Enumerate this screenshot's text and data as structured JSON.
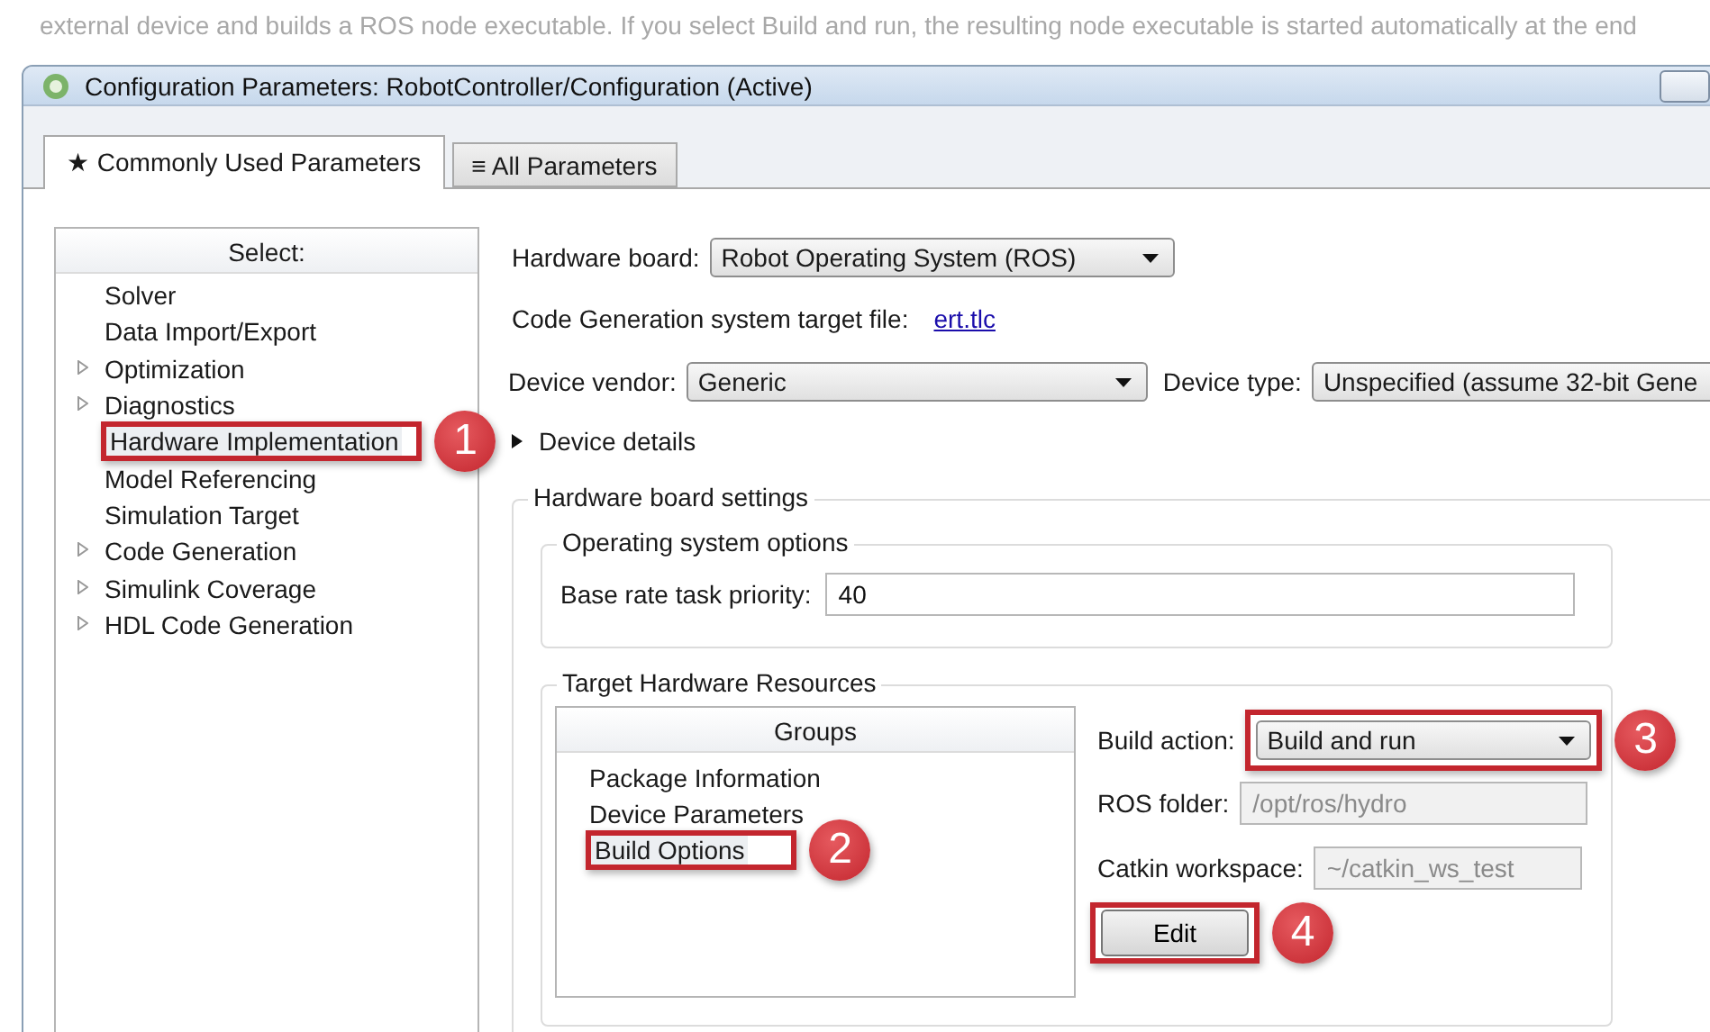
{
  "caption": "external device and builds a ROS node executable. If you select Build and run, the resulting node executable is started automatically at the end",
  "window": {
    "title": "Configuration Parameters: RobotController/Configuration (Active)"
  },
  "tabs": [
    {
      "icon": "★",
      "label": "Commonly Used Parameters",
      "selected": true
    },
    {
      "icon": "≡",
      "label": "All Parameters",
      "selected": false
    }
  ],
  "sidebar": {
    "header": "Select:",
    "items": [
      {
        "label": "Solver",
        "expandable": false,
        "selected": false
      },
      {
        "label": "Data Import/Export",
        "expandable": false,
        "selected": false
      },
      {
        "label": "Optimization",
        "expandable": true,
        "selected": false
      },
      {
        "label": "Diagnostics",
        "expandable": true,
        "selected": false
      },
      {
        "label": "Hardware Implementation",
        "expandable": false,
        "selected": true,
        "callout": "1"
      },
      {
        "label": "Model Referencing",
        "expandable": false,
        "selected": false
      },
      {
        "label": "Simulation Target",
        "expandable": false,
        "selected": false
      },
      {
        "label": "Code Generation",
        "expandable": true,
        "selected": false
      },
      {
        "label": "Simulink Coverage",
        "expandable": true,
        "selected": false
      },
      {
        "label": "HDL Code Generation",
        "expandable": true,
        "selected": false
      }
    ]
  },
  "hardware_board": {
    "label": "Hardware board:",
    "value": "Robot Operating System (ROS)"
  },
  "target_file": {
    "label": "Code Generation system target file:",
    "link": "ert.tlc"
  },
  "device_vendor": {
    "label": "Device vendor:",
    "value": "Generic"
  },
  "device_type": {
    "label": "Device type:",
    "value": "Unspecified (assume 32-bit Gene"
  },
  "device_details": {
    "label": "Device details",
    "expanded": false
  },
  "hardware_board_settings": {
    "legend": "Hardware board settings",
    "os_options": {
      "legend": "Operating system options",
      "priority": {
        "label": "Base rate task priority:",
        "value": "40"
      }
    },
    "target_resources": {
      "legend": "Target Hardware Resources",
      "groups": {
        "header": "Groups",
        "items": [
          {
            "label": "Package Information",
            "selected": false
          },
          {
            "label": "Device Parameters",
            "selected": false
          },
          {
            "label": "Build Options",
            "selected": true,
            "callout": "2"
          }
        ]
      },
      "build_action": {
        "label": "Build action:",
        "value": "Build and run",
        "callout": "3"
      },
      "ros_folder": {
        "label": "ROS folder:",
        "value": "/opt/ros/hydro",
        "disabled": true
      },
      "catkin_workspace": {
        "label": "Catkin workspace:",
        "value": "~/catkin_ws_test",
        "disabled": true
      },
      "edit_button": {
        "label": "Edit",
        "callout": "4"
      }
    }
  }
}
